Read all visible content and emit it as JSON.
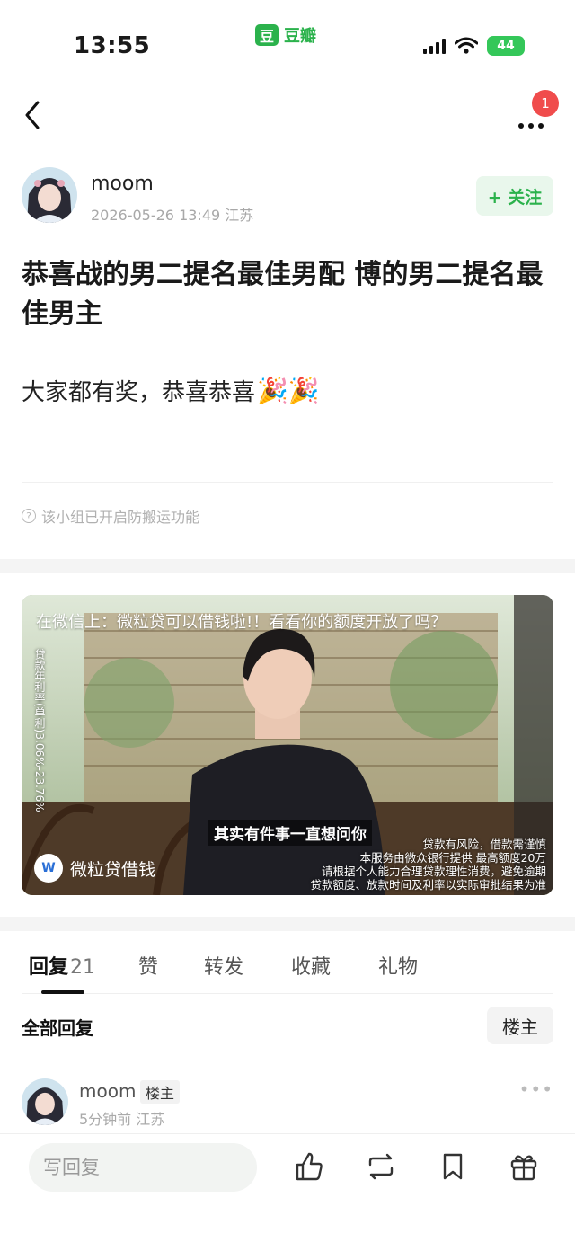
{
  "status_bar": {
    "time": "13:55",
    "app_logo": "豆",
    "app_name": "豆瓣",
    "battery": "44"
  },
  "nav": {
    "notification_count": "1"
  },
  "post": {
    "author": "moom",
    "meta": "2026-05-26 13:49  江苏",
    "follow_label": "+ 关注",
    "title": "恭喜战的男二提名最佳男配 博的男二提名最佳男主",
    "body": "大家都有奖，恭喜恭喜",
    "body_emoji": "🎉🎉",
    "notice": "该小组已开启防搬运功能"
  },
  "ad": {
    "headline": "在微信上：微粒贷可以借钱啦!！看看你的额度开放了吗？",
    "vertical_text": "贷款年利率(单利)3.06%-23.76%",
    "subtitle": "其实有件事一直想问你",
    "brand_logo": "W 微粒贷",
    "brand_name": "微粒贷借钱",
    "disclaimer": [
      "贷款有风险，借款需谨慎",
      "本服务由微众银行提供 最高额度20万",
      "请根据个人能力合理贷款理性消费，避免逾期",
      "贷款额度、放款时间及利率以实际审批结果为准"
    ]
  },
  "tabs": [
    {
      "label": "回复",
      "count": "21"
    },
    {
      "label": "赞"
    },
    {
      "label": "转发"
    },
    {
      "label": "收藏"
    },
    {
      "label": "礼物"
    }
  ],
  "replies": {
    "heading": "全部回复",
    "filter_label": "楼主",
    "items": [
      {
        "name": "moom",
        "tag": "楼主",
        "meta": "5分钟前  江苏"
      }
    ]
  },
  "bottom_bar": {
    "input_placeholder": "写回复",
    "actions": [
      "like-icon",
      "repost-icon",
      "bookmark-icon",
      "gift-icon"
    ]
  },
  "colors": {
    "brand_green": "#2bb24c",
    "badge_red": "#f04c4c",
    "follow_bg": "#e9f7ec"
  }
}
